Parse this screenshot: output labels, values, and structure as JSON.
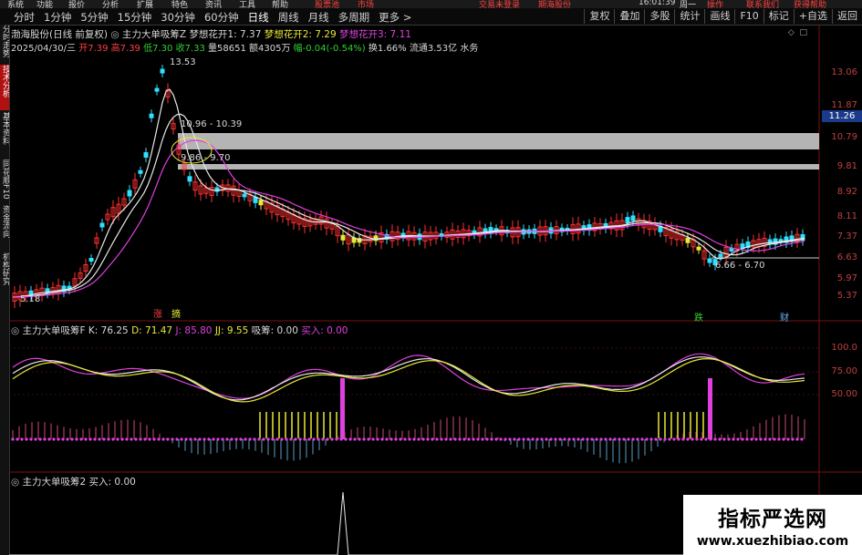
{
  "app": {
    "topbar_items": [
      "系统",
      "功能",
      "报价",
      "分析",
      "扩展",
      "特色",
      "资讯",
      "工具",
      "帮助",
      "股票池",
      "市场",
      "交易未登录",
      "期海股份",
      "16:01:39",
      "周一",
      "操作",
      "联系我们",
      "获得帮助"
    ]
  },
  "toolbar": {
    "tabs": [
      "分时",
      "1分钟",
      "5分钟",
      "15分钟",
      "30分钟",
      "60分钟",
      "日线",
      "周线",
      "月线",
      "多周期",
      "更多 >"
    ],
    "active_tab": "日线",
    "right_buttons": [
      "复权",
      "叠加",
      "多股",
      "统计",
      "画线",
      "F10",
      "标记",
      "+自选",
      "返回"
    ]
  },
  "sidebar": {
    "tabs": [
      "分时走势",
      "技术分析",
      "基本资料",
      "同花顺F10",
      "资金流向",
      "机构研究"
    ]
  },
  "main_pane": {
    "stock_title": "渤海股份(日线 前复权)",
    "indicator_name": "主力大单吸筹Z",
    "ma1": "梦想花开1: 7.37",
    "ma2": "梦想花开2: 7.29",
    "ma3": "梦想花开3: 7.11",
    "date": "2025/04/30/三",
    "open": "开7.39",
    "high": "高7.39",
    "low": "低7.30",
    "close": "收7.33",
    "volume": "量58651",
    "amount": "额4305万",
    "change": "幅-0.04(-0.54%)",
    "turnover": "换1.66%",
    "float": "流通3.53亿",
    "sector": "水务",
    "price_axis": [
      "13.06",
      "11.87",
      "10.79",
      "9.81",
      "8.92",
      "8.11",
      "7.37",
      "6.63",
      "5.97",
      "5.37"
    ],
    "current_price_tag": "11.26",
    "annotations": {
      "high": "13.53",
      "low_start": "5.18",
      "gap1": "10.96 - 10.39",
      "gap2": "9.86 - 9.70",
      "gap3": "6.66 - 6.70",
      "tag_up": "涨",
      "tag_news": "摘",
      "tag_down": "跌",
      "tag_fin": "财"
    }
  },
  "kdj_pane": {
    "name": "主力大单吸筹F",
    "k": "K: 76.25",
    "d": "D: 71.47",
    "j": "J: 85.80",
    "jj": "JJ: 9.55",
    "xichou": "吸筹: 0.00",
    "buy": "买入: 0.00",
    "axis": [
      "100.0",
      "75.00",
      "50.00"
    ]
  },
  "buy_pane": {
    "name": "主力大单吸筹2",
    "buy": "买入: 0.00"
  },
  "watermark": {
    "line1": "指标严选网",
    "line2": "www.xuezhibiao.com"
  },
  "colors": {
    "up": "#ff3030",
    "down": "#30e0ff",
    "yellow": "#e8e838",
    "magenta": "#e040e0",
    "white": "#e8e8e8",
    "gap_band": "#b4b4b4"
  }
}
